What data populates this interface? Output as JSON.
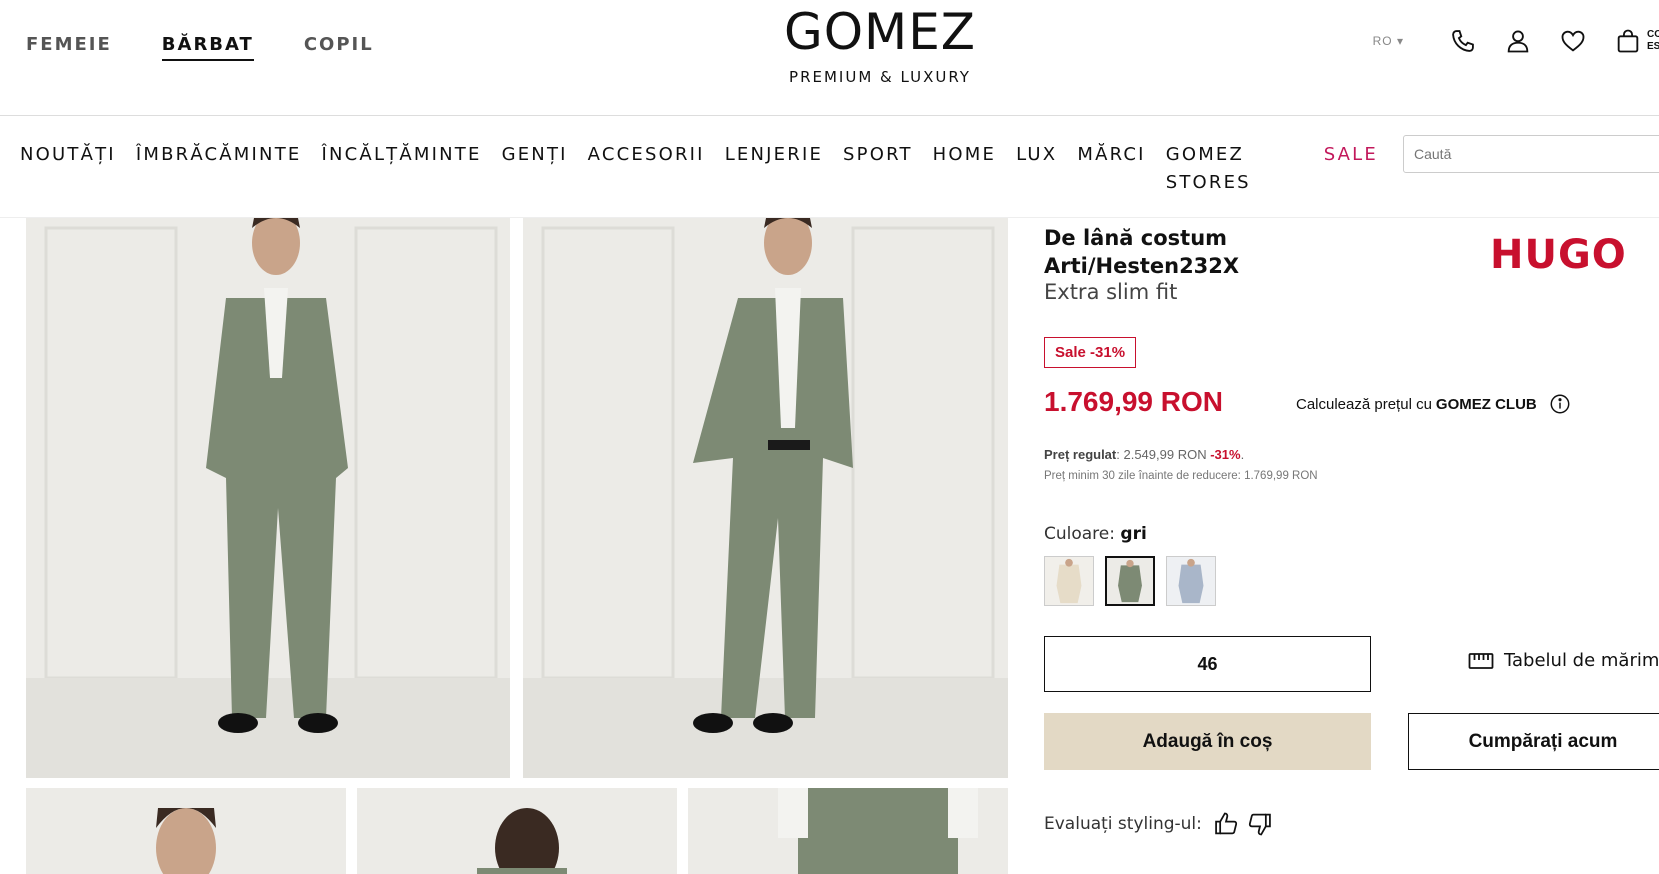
{
  "header": {
    "gender_tabs": [
      {
        "label": "FEMEIE",
        "active": false
      },
      {
        "label": "BĂRBAT",
        "active": true
      },
      {
        "label": "COPIL",
        "active": false
      }
    ],
    "logo_main": "GOMEZ",
    "logo_sub": "PREMIUM & LUXURY",
    "language": "RO ▾",
    "cart_label": "CO ES",
    "icons": [
      "phone-icon",
      "user-icon",
      "heart-icon",
      "bag-icon"
    ]
  },
  "categories": [
    "NOUTĂȚI",
    "ÎMBRĂCĂMINTE",
    "ÎNCĂLȚĂMINTE",
    "GENȚI",
    "ACCESORII",
    "LENJERIE",
    "SPORT",
    "HOME",
    "LUX",
    "MĂRCI",
    "GOMEZ STORES"
  ],
  "sale_label": "SALE",
  "search": {
    "placeholder": "Caută"
  },
  "product": {
    "title": "De lână costum Arti/Hesten232X",
    "fit": "Extra slim fit",
    "brand": "HUGO",
    "sale_badge": "Sale -31%",
    "price": "1.769,99 RON",
    "club_text": "Calculează prețul cu",
    "club_name": "GOMEZ CLUB",
    "regular_label": "Preț regulat",
    "regular_value": ": 2.549,99 RON",
    "regular_discount": "-31%",
    "regular_end": ".",
    "min30": "Preț minim 30 zile înainte de reducere: 1.769,99 RON",
    "color_label": "Culoare:",
    "color_value": "gri",
    "swatch_colors": [
      "#e6dcc8",
      "#7d8a74",
      "#a9b6c9"
    ],
    "selected_swatch": 1,
    "size": "46",
    "size_table": "Tabelul de mărimi",
    "add_to_cart": "Adaugă în coș",
    "buy_now": "Cumpărați acum",
    "rate_styling": "Evaluați styling-ul:"
  },
  "colors": {
    "brand_red": "#c8102e",
    "sale_pink": "#c2185b",
    "beige_button": "#e3d9c5"
  }
}
